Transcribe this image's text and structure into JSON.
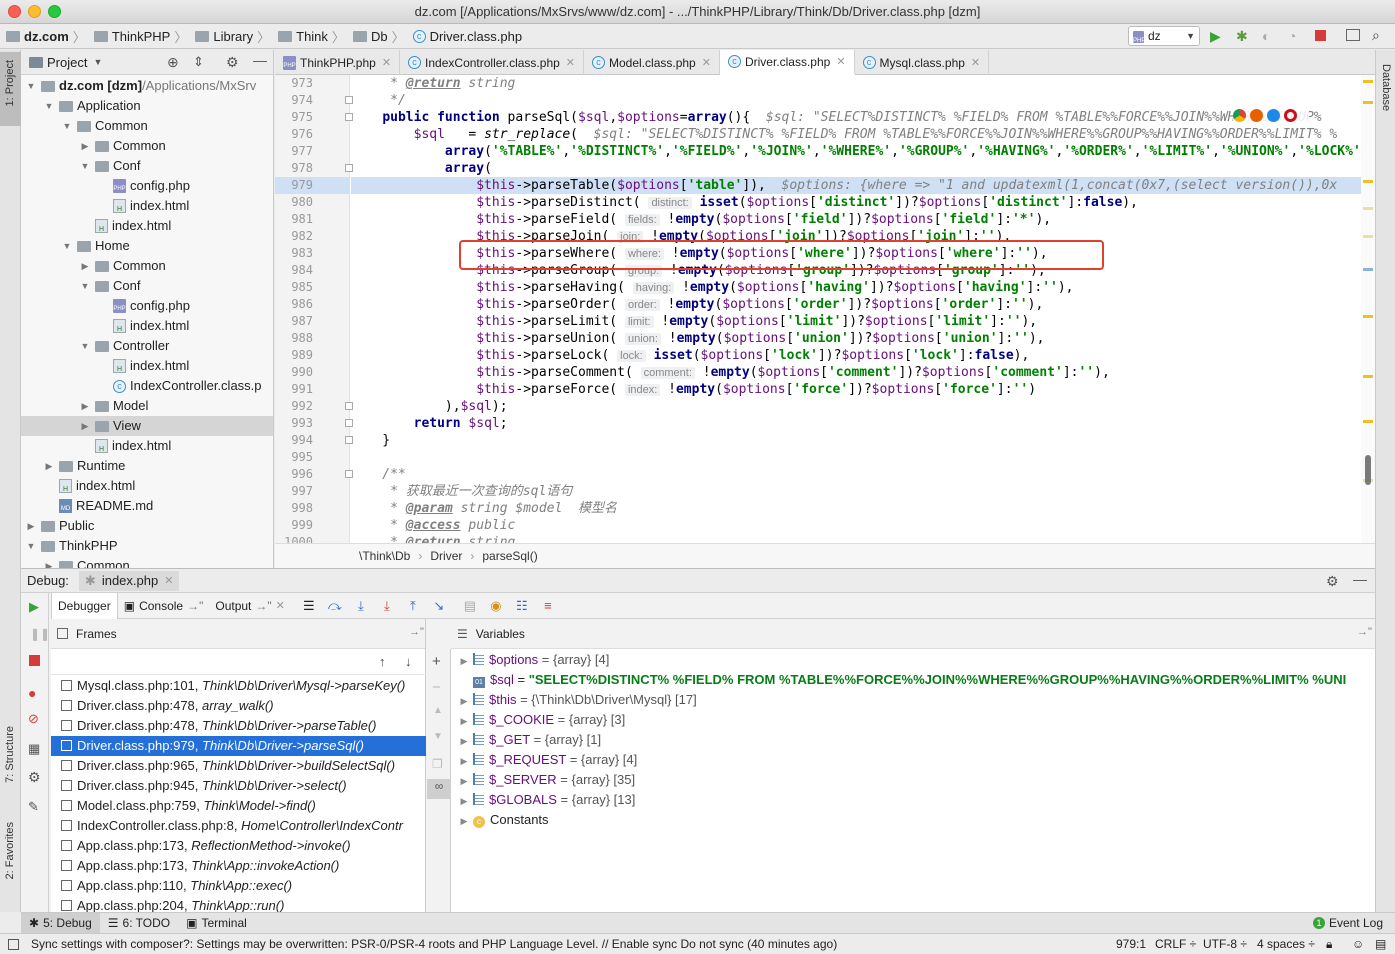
{
  "window": {
    "title": "dz.com [/Applications/MxSrvs/www/dz.com] - .../ThinkPHP/Library/Think/Db/Driver.class.php [dzm]"
  },
  "navbar": {
    "crumbs": [
      "dz.com",
      "ThinkPHP",
      "Library",
      "Think",
      "Db",
      "Driver.class.php"
    ],
    "run_config": "dz"
  },
  "left_tool": {
    "project": "1: Project",
    "structure": "7: Structure",
    "favorites": "2: Favorites"
  },
  "right_tool": {
    "database": "Database"
  },
  "project": {
    "header": "Project",
    "tree": [
      {
        "label": "dz.com [dzm]",
        "suffix": " /Applications/MxSrv",
        "depth": 0,
        "type": "folder",
        "open": true
      },
      {
        "label": "Application",
        "depth": 1,
        "type": "folder",
        "open": true
      },
      {
        "label": "Common",
        "depth": 2,
        "type": "folder",
        "open": true
      },
      {
        "label": "Common",
        "depth": 3,
        "type": "folder",
        "open": false
      },
      {
        "label": "Conf",
        "depth": 3,
        "type": "folder",
        "open": true
      },
      {
        "label": "config.php",
        "depth": 4,
        "type": "php"
      },
      {
        "label": "index.html",
        "depth": 4,
        "type": "html"
      },
      {
        "label": "index.html",
        "depth": 3,
        "type": "html"
      },
      {
        "label": "Home",
        "depth": 2,
        "type": "folder",
        "open": true
      },
      {
        "label": "Common",
        "depth": 3,
        "type": "folder",
        "open": false
      },
      {
        "label": "Conf",
        "depth": 3,
        "type": "folder",
        "open": true
      },
      {
        "label": "config.php",
        "depth": 4,
        "type": "php"
      },
      {
        "label": "index.html",
        "depth": 4,
        "type": "html"
      },
      {
        "label": "Controller",
        "depth": 3,
        "type": "folder",
        "open": true
      },
      {
        "label": "index.html",
        "depth": 4,
        "type": "html"
      },
      {
        "label": "IndexController.class.p",
        "depth": 4,
        "type": "class"
      },
      {
        "label": "Model",
        "depth": 3,
        "type": "folder",
        "open": false
      },
      {
        "label": "View",
        "depth": 3,
        "type": "folder",
        "open": false,
        "selected": true
      },
      {
        "label": "index.html",
        "depth": 3,
        "type": "html"
      },
      {
        "label": "Runtime",
        "depth": 1,
        "type": "folder",
        "open": false
      },
      {
        "label": "index.html",
        "depth": 1,
        "type": "html"
      },
      {
        "label": "README.md",
        "depth": 1,
        "type": "md"
      },
      {
        "label": "Public",
        "depth": 0,
        "type": "folder",
        "open": false
      },
      {
        "label": "ThinkPHP",
        "depth": 0,
        "type": "folder",
        "open": true
      },
      {
        "label": "Common",
        "depth": 1,
        "type": "folder",
        "open": false
      }
    ]
  },
  "editor": {
    "tabs": [
      {
        "label": "ThinkPHP.php",
        "icon": "php"
      },
      {
        "label": "IndexController.class.php",
        "icon": "class"
      },
      {
        "label": "Model.class.php",
        "icon": "class"
      },
      {
        "label": "Driver.class.php",
        "icon": "class",
        "active": true
      },
      {
        "label": "Mysql.class.php",
        "icon": "class"
      }
    ],
    "first_line": 973,
    "current_line": 979,
    "breadcrumb": [
      "\\Think\\Db",
      "Driver",
      "parseSql()"
    ],
    "hints": {
      "sql975": "$sql: \"SELECT%DISTINCT% %FIELD% FROM %TABLE%%FORCE%%JOIN%%WHERE%%GROUP%",
      "sql976": "$sql: \"SELECT%DISTINCT% %FIELD% FROM %TABLE%%FORCE%%JOIN%%WHERE%%GROUP%%HAVING%%ORDER%%LIMIT% %",
      "opt979": "$options: {where => \"1 and updatexml(1,concat(0x7,(select version()),0x",
      "distinct": "distinct:",
      "fields": "fields:",
      "join": "join:",
      "where": "where:",
      "group": "group:",
      "having": "having:",
      "order": "order:",
      "limit": "limit:",
      "union": "union:",
      "lock": "lock:",
      "comment": "comment:",
      "index": "index:"
    },
    "doc_cn_1": "获取最近一次查询的sql语句",
    "doc_cn_2": "模型名"
  },
  "debug": {
    "title": "Debug:",
    "config": "index.php",
    "tabs": [
      "Debugger",
      "Console",
      "Output"
    ],
    "frames_title": "Frames",
    "variables_title": "Variables",
    "frames": [
      {
        "file": "Mysql.class.php:101,",
        "method": "Think\\Db\\Driver\\Mysql->parseKey()"
      },
      {
        "file": "Driver.class.php:478,",
        "method": "array_walk()"
      },
      {
        "file": "Driver.class.php:478,",
        "method": "Think\\Db\\Driver->parseTable()"
      },
      {
        "file": "Driver.class.php:979,",
        "method": "Think\\Db\\Driver->parseSql()",
        "selected": true
      },
      {
        "file": "Driver.class.php:965,",
        "method": "Think\\Db\\Driver->buildSelectSql()"
      },
      {
        "file": "Driver.class.php:945,",
        "method": "Think\\Db\\Driver->select()"
      },
      {
        "file": "Model.class.php:759,",
        "method": "Think\\Model->find()"
      },
      {
        "file": "IndexController.class.php:8,",
        "method": "Home\\Controller\\IndexContr"
      },
      {
        "file": "App.class.php:173,",
        "method": "ReflectionMethod->invoke()"
      },
      {
        "file": "App.class.php:173,",
        "method": "Think\\App::invokeAction()"
      },
      {
        "file": "App.class.php:110,",
        "method": "Think\\App::exec()"
      },
      {
        "file": "App.class.php:204,",
        "method": "Think\\App::run()"
      }
    ],
    "variables": [
      {
        "name": "$options",
        "value": " = {array} [4]",
        "expandable": true,
        "kind": "array"
      },
      {
        "name": "$sql",
        "value": "\"SELECT%DISTINCT% %FIELD% FROM %TABLE%%FORCE%%JOIN%%WHERE%%GROUP%%HAVING%%ORDER%%LIMIT% %UNI",
        "expandable": false,
        "kind": "string"
      },
      {
        "name": "$this",
        "value": " = {\\Think\\Db\\Driver\\Mysql} [17]",
        "expandable": true,
        "kind": "array"
      },
      {
        "name": "$_COOKIE",
        "value": " = {array} [3]",
        "expandable": true,
        "kind": "array"
      },
      {
        "name": "$_GET",
        "value": " = {array} [1]",
        "expandable": true,
        "kind": "array"
      },
      {
        "name": "$_REQUEST",
        "value": " = {array} [4]",
        "expandable": true,
        "kind": "array"
      },
      {
        "name": "$_SERVER",
        "value": " = {array} [35]",
        "expandable": true,
        "kind": "array"
      },
      {
        "name": "$GLOBALS",
        "value": " = {array} [13]",
        "expandable": true,
        "kind": "array"
      },
      {
        "name": "Constants",
        "value": "",
        "expandable": true,
        "kind": "const"
      }
    ]
  },
  "bottom_tabs": [
    "5: Debug",
    "6: TODO",
    "Terminal"
  ],
  "event_log": "Event Log",
  "status": {
    "message": "Sync settings with composer?: Settings may be overwritten: PSR-0/PSR-4 roots and PHP Language Level. // Enable sync Do not sync (40 minutes ago)",
    "position": "979:1",
    "line_sep": "CRLF ÷",
    "encoding": "UTF-8 ÷",
    "indent": "4 spaces ÷"
  }
}
